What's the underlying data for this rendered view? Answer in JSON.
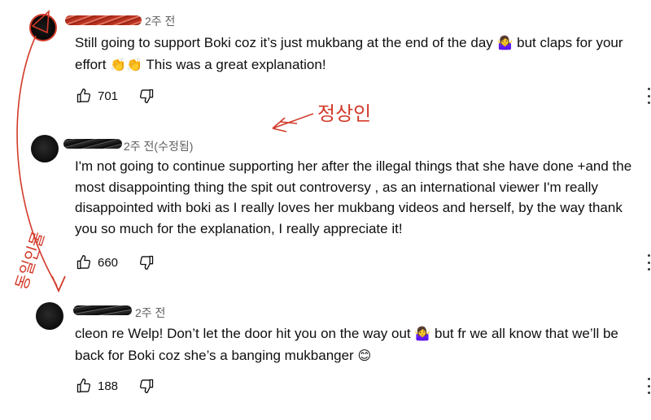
{
  "comments": [
    {
      "time": "2주 전",
      "text_before": "Still going to support Boki coz it’s just mukbang at the end of the day ",
      "emoji1": "🤷‍♀️",
      "text_middle": " but claps for your effort ",
      "emoji2": "👏👏",
      "text_after": " This was a great explanation!",
      "likes": "701"
    },
    {
      "time": "2주 전(수정됨)",
      "text": "I'm not going to continue  supporting her after the illegal things that she have done +and the most disappointing thing the spit out controversy , as an international viewer I'm really disappointed with boki as I really loves her mukbang videos and herself, by the way thank you so much for the explanation, I really appreciate it!",
      "likes": "660"
    },
    {
      "time": "2주 전",
      "text_before": "cleon re Welp! Don’t let the door hit you on the way out ",
      "emoji1": "🤷‍♀️",
      "text_middle": " but fr we all know that we’ll be back for Boki coz she’s a banging mukbanger ",
      "emoji2": "😊",
      "likes": "188"
    }
  ],
  "annotations": {
    "note_top": "정상인",
    "note_side": "동일인물",
    "color": "#d23a2a"
  },
  "icons": [
    "like-icon",
    "dislike-icon",
    "more-icon"
  ]
}
